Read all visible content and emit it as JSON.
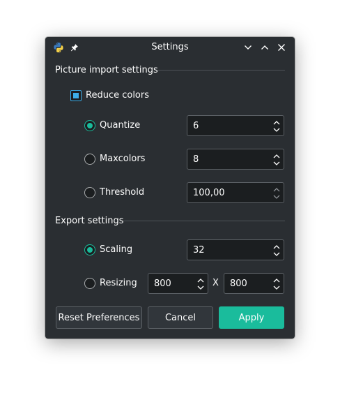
{
  "window": {
    "title": "Settings",
    "icons": [
      "python-logo-icon",
      "pin-icon",
      "minimize-icon",
      "maximize-icon",
      "close-icon"
    ]
  },
  "picture_import": {
    "heading": "Picture import settings",
    "reduce_colors": {
      "label": "Reduce colors",
      "checked": true
    },
    "quantize": {
      "label": "Quantize",
      "selected": true,
      "value": "6"
    },
    "maxcolors": {
      "label": "Maxcolors",
      "selected": false,
      "value": "8"
    },
    "threshold": {
      "label": "Threshold",
      "selected": false,
      "value": "100,00"
    }
  },
  "export": {
    "heading": "Export settings",
    "scaling": {
      "label": "Scaling",
      "selected": true,
      "value": "32"
    },
    "resizing": {
      "label": "Resizing",
      "selected": false,
      "width": "800",
      "separator": "X",
      "height": "800"
    }
  },
  "buttons": {
    "reset": "Reset Preferences",
    "cancel": "Cancel",
    "apply": "Apply"
  },
  "colors": {
    "window_bg": "#2a2e32",
    "accent": "#1abc9c",
    "field_bg": "#1b1e20"
  }
}
